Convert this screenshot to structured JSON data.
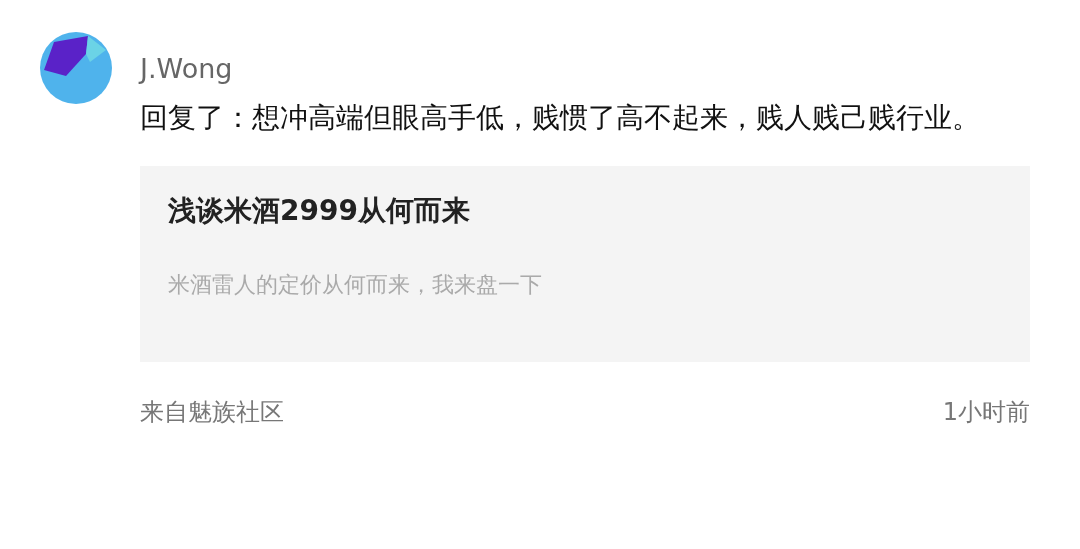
{
  "comment": {
    "author": "J.Wong",
    "text": "回复了：想冲高端但眼高手低，贱惯了高不起来，贱人贱己贱行业。"
  },
  "quoted_post": {
    "title": "浅谈米酒2999从何而来",
    "summary": "米酒雷人的定价从何而来，我来盘一下"
  },
  "footer": {
    "source": "来自魅族社区",
    "time": "1小时前"
  }
}
